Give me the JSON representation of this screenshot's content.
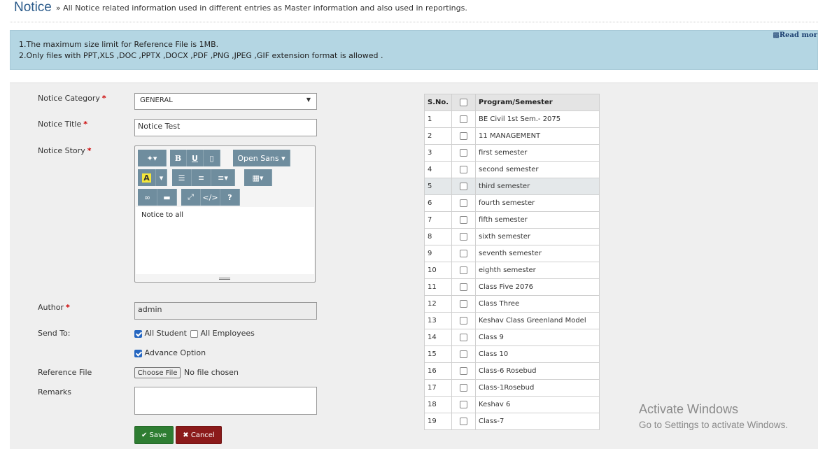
{
  "header": {
    "title": "Notice",
    "subtitle": "» All Notice related information used in different entries as Master information and also used in reportings."
  },
  "info": {
    "line1": "1.The maximum size limit for Reference File is 1MB.",
    "line2": "2.Only files with PPT,XLS ,DOC ,PPTX ,DOCX ,PDF ,PNG ,JPEG ,GIF extension format is allowed .",
    "read_more": "Read mor"
  },
  "form": {
    "category_label": "Notice Category",
    "category_value": "GENERAL",
    "title_label": "Notice Title",
    "title_value": "Notice Test",
    "story_label": "Notice Story",
    "story_text": "Notice to all",
    "font_button": "Open Sans",
    "help_button": "?",
    "author_label": "Author",
    "author_value": "admin",
    "required_mark": "*",
    "send_to_label": "Send To:",
    "all_student": "All Student",
    "all_student_checked": true,
    "all_employees": "All Employees",
    "all_employees_checked": false,
    "advance_option": "Advance Option",
    "advance_option_checked": true,
    "reference_label": "Reference File",
    "choose_file": "Choose File",
    "no_file": "No file chosen",
    "remarks_label": "Remarks",
    "remarks_value": "",
    "save": "Save",
    "cancel": "Cancel"
  },
  "programs": {
    "headers": [
      "S.No.",
      "",
      "Program/Semester"
    ],
    "rows": [
      {
        "sn": "1",
        "name": "BE Civil 1st Sem.- 2075"
      },
      {
        "sn": "2",
        "name": "11 MANAGEMENT"
      },
      {
        "sn": "3",
        "name": "first semester"
      },
      {
        "sn": "4",
        "name": "second semester"
      },
      {
        "sn": "5",
        "name": "third semester"
      },
      {
        "sn": "6",
        "name": "fourth semester"
      },
      {
        "sn": "7",
        "name": "fifth semester"
      },
      {
        "sn": "8",
        "name": "sixth semester"
      },
      {
        "sn": "9",
        "name": "seventh semester"
      },
      {
        "sn": "10",
        "name": "eighth semester"
      },
      {
        "sn": "11",
        "name": "Class Five 2076"
      },
      {
        "sn": "12",
        "name": "Class Three"
      },
      {
        "sn": "13",
        "name": "Keshav Class Greenland Model"
      },
      {
        "sn": "14",
        "name": "Class 9"
      },
      {
        "sn": "15",
        "name": "Class 10"
      },
      {
        "sn": "16",
        "name": "Class-6 Rosebud"
      },
      {
        "sn": "17",
        "name": "Class-1Rosebud"
      },
      {
        "sn": "18",
        "name": "Keshav 6"
      },
      {
        "sn": "19",
        "name": "Class-7"
      }
    ],
    "highlighted_row": "5"
  },
  "watermark": {
    "line1": "Activate Windows",
    "line2": "Go to Settings to activate Windows."
  },
  "colors": {
    "save": "#2e7d32",
    "cancel": "#8b1a1a",
    "toolbar": "#6f8d9e",
    "info_bg": "#b4d6e3"
  }
}
